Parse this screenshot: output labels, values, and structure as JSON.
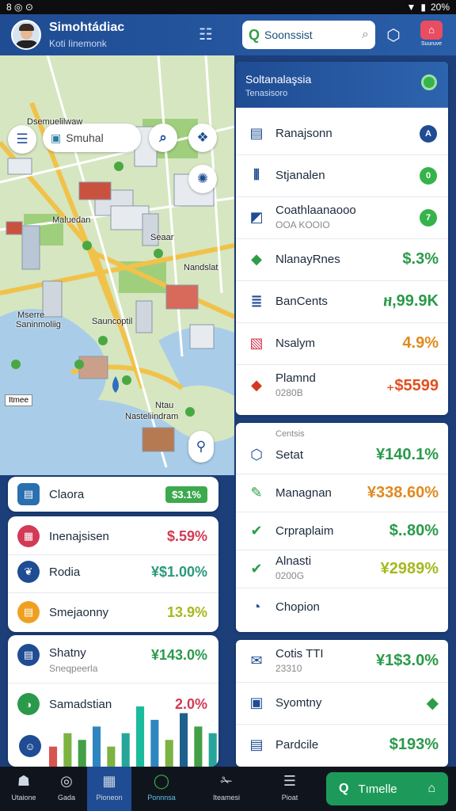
{
  "status_bar": {
    "left_icons": "8 ◎ ⊙",
    "time": "20%",
    "signal": "▼",
    "battery": "▮"
  },
  "header": {
    "title": "Simohtádiac",
    "subtitle": "Koti Iinemonk",
    "search": {
      "value": "Soonssist",
      "placeholder": "Soonssist"
    },
    "brand_label": "Suuruve"
  },
  "map": {
    "search_value": "Smuhal",
    "labels": [
      "Dsemuelilwaw",
      "Maluedan",
      "Seaar",
      "Nandslat",
      "Mserre",
      "Sauncoptil",
      "Ntau",
      "Nasteliindram",
      "Saninmoliig"
    ],
    "badge": "Itmee"
  },
  "left_cards": {
    "top": {
      "label": "Claora",
      "value": "$3.1%"
    },
    "middle": [
      {
        "label": "Inenajsisen",
        "value": "$.59%",
        "color": "#d23a55"
      },
      {
        "label": "Rodia",
        "value": "¥$1.00%",
        "color": "#2a9a7a"
      },
      {
        "label": "Smejaonny",
        "value": "13.9%",
        "color": "#a6b81f"
      }
    ],
    "bottom": [
      {
        "label": "Shatny",
        "sub": "Sneqpeerla",
        "value": "¥143.0%",
        "color": "#2a9a4a"
      },
      {
        "label": "Samadstian",
        "value": "2.0%",
        "color": "#d23a55"
      }
    ],
    "chart_data": {
      "type": "bar",
      "values": [
        3,
        5,
        4,
        6,
        3,
        5,
        9,
        7,
        4,
        8,
        6,
        5
      ],
      "colors": [
        "#d9534f",
        "#7cb342",
        "#43a047",
        "#2e86c1",
        "#7cb342",
        "#26a69a",
        "#1abc9c",
        "#2e86c1",
        "#7cb342",
        "#1f618d",
        "#43a047",
        "#26a69a"
      ]
    }
  },
  "right_panel": {
    "header": {
      "title": "Soltanalaşsia",
      "subtitle": "Tenasisoro"
    },
    "list1": [
      {
        "label": "Ranajsonn",
        "badge": "A",
        "badge_color": "#1f4c93",
        "icon_color": "#1f4c93"
      },
      {
        "label": "Stjanalen",
        "badge": "0",
        "badge_color": "#36b34a",
        "icon_color": "#1f4c93"
      },
      {
        "label": "Coathlaanaooo",
        "sub": "OOA KOOIO",
        "badge": "7",
        "badge_color": "#36b34a",
        "icon_color": "#1f4c93"
      },
      {
        "label": "NlanayRnes",
        "value": "$.3%",
        "value_color": "#2a9a4a",
        "icon_color": "#2e9d48"
      },
      {
        "label": "BanCents",
        "value": "ዘ,99.9K",
        "value_color": "#2a9a4a",
        "icon_color": "#1f4c93"
      },
      {
        "label": "Nsalym",
        "value": "4.9%",
        "value_color": "#e08a1f",
        "icon_color": "#d23a55"
      },
      {
        "label": "Plamnd",
        "sub": "0280B",
        "value": "₊$5599",
        "value_color": "#e0501f",
        "icon_color": "#d23a22"
      }
    ],
    "list2": {
      "caption": "Centsis",
      "items": [
        {
          "label": "Setat",
          "value": "¥140.1%",
          "value_color": "#2a9a4a",
          "icon": "⬡",
          "icon_color": "#1f4c93"
        },
        {
          "label": "Managnan",
          "value": "¥338.60%",
          "value_color": "#e08a1f",
          "icon": "✎",
          "icon_color": "#2e9d48"
        },
        {
          "label": "Crpraplaim",
          "value": "$..80%",
          "value_color": "#2a9a4a",
          "icon": "✔",
          "icon_color": "#2e9d48"
        },
        {
          "label": "Alnasti",
          "sub": "0200G",
          "value": "¥2989%",
          "value_color": "#a6b81f",
          "icon": "✔",
          "icon_color": "#2e9d48"
        },
        {
          "label": "Chopion",
          "value": "",
          "icon": "◔",
          "icon_color": "#1f4c93"
        }
      ]
    },
    "list3": [
      {
        "label": "Cotis TTI",
        "sub": "23310",
        "value": "¥1$3.0%",
        "value_color": "#2a9a4a",
        "icon": "✉",
        "icon_color": "#1f4c93"
      },
      {
        "label": "Syomtny",
        "value": "◆",
        "value_color": "#2e9d48",
        "icon": "▣",
        "icon_color": "#1f4c93"
      },
      {
        "label": "Pardcile",
        "value": "$193%",
        "value_color": "#2a9a4a",
        "icon": "▤",
        "icon_color": "#1f4c93"
      }
    ]
  },
  "bottom_nav": {
    "items": [
      {
        "label": "Utaione",
        "icon": "☗"
      },
      {
        "label": "Gada",
        "icon": "◎"
      },
      {
        "label": "Pioneon",
        "icon": "▦"
      },
      {
        "label": "Ponnnsa",
        "icon": "◯"
      },
      {
        "label": "Iteamesi",
        "icon": "✁"
      },
      {
        "label": "Pioat",
        "icon": "☰"
      }
    ],
    "cta": {
      "label": "Tımelle",
      "icon": "Q",
      "right_icon": "⌂"
    }
  }
}
